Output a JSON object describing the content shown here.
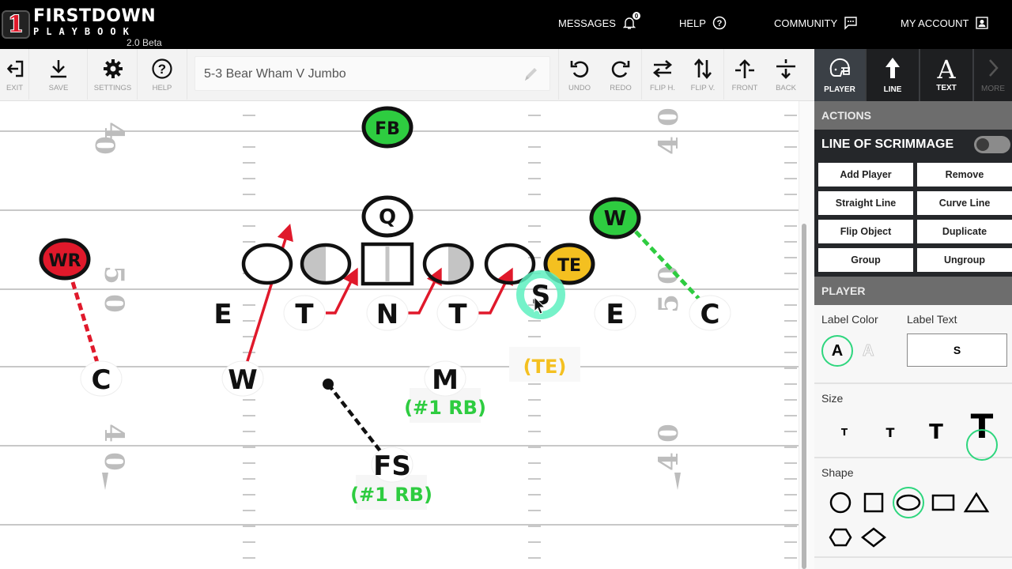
{
  "app": {
    "logo_number": "1",
    "logo_line1": "FIRSTDOWN",
    "logo_line2": "PLAYBOOK",
    "version": "2.0 Beta"
  },
  "topnav": {
    "messages": "MESSAGES",
    "messages_count": "0",
    "help": "HELP",
    "community": "COMMUNITY",
    "account": "MY ACCOUNT"
  },
  "toolbar": {
    "exit": "EXIT",
    "save": "SAVE",
    "settings": "SETTINGS",
    "help": "HELP",
    "play_title": "5-3 Bear Wham V Jumbo",
    "undo": "UNDO",
    "redo": "REDO",
    "flip_h": "FLIP H.",
    "flip_v": "FLIP V.",
    "front": "FRONT",
    "back": "BACK"
  },
  "tabs": [
    {
      "label": "PLAYER",
      "icon": "helmet-icon",
      "active": true
    },
    {
      "label": "LINE",
      "icon": "arrow-up-icon",
      "active": false
    },
    {
      "label": "TEXT",
      "icon": "letter-a-icon",
      "active": false
    },
    {
      "label": "MORE",
      "icon": "chevron-right-icon",
      "active": false
    }
  ],
  "panel": {
    "actions_title": "ACTIONS",
    "los_label": "LINE OF SCRIMMAGE",
    "los_enabled": false,
    "actions": [
      "Add Player",
      "Remove",
      "Straight Line",
      "Curve Line",
      "Flip Object",
      "Duplicate",
      "Group",
      "Ungroup"
    ],
    "player_title": "PLAYER",
    "label_color_title": "Label Color",
    "label_text_title": "Label Text",
    "label_color_dark": "A",
    "label_color_light": "A",
    "label_text_value": "S",
    "size_title": "Size",
    "size_glyph": "T",
    "size_selected": "largest",
    "shape_title": "Shape",
    "shape_options": [
      "circle",
      "square",
      "ellipse",
      "rectangle",
      "triangle",
      "hexagon",
      "diamond"
    ],
    "shape_selected": "ellipse"
  },
  "field": {
    "yard_numbers": [
      "40",
      "50",
      "40"
    ],
    "offense": [
      {
        "label": "FB",
        "color": "#2ecc40"
      },
      {
        "label": "Q",
        "color": "#ffffff"
      },
      {
        "label": "WR",
        "color": "#e0192b"
      },
      {
        "label": "W",
        "color": "#2ecc40"
      },
      {
        "label": "TE",
        "color": "#f4c020"
      }
    ],
    "defense": [
      {
        "label": "E"
      },
      {
        "label": "T"
      },
      {
        "label": "N"
      },
      {
        "label": "T"
      },
      {
        "label": "S"
      },
      {
        "label": "E"
      },
      {
        "label": "C"
      },
      {
        "label": "C"
      },
      {
        "label": "W"
      },
      {
        "label": "M"
      },
      {
        "label": "FS"
      }
    ],
    "annotations": [
      {
        "text": "(TE)",
        "color": "#f4c020"
      },
      {
        "text": "(#1 RB)",
        "color": "#2ecc40"
      },
      {
        "text": "(#1 RB)",
        "color": "#2ecc40"
      }
    ],
    "colors": {
      "route": "#e0192b",
      "green_route": "#2ecc40",
      "select": "#5ef0c0"
    }
  }
}
